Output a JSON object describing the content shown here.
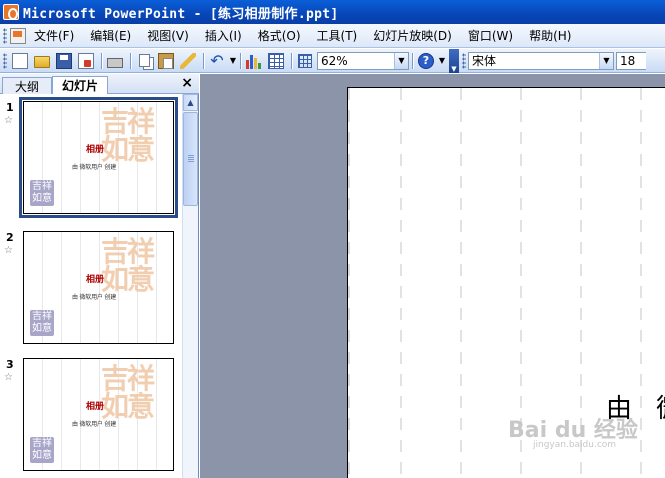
{
  "window": {
    "title": "Microsoft PowerPoint - [练习相册制作.ppt]"
  },
  "menu": {
    "items": [
      "文件(F)",
      "编辑(E)",
      "视图(V)",
      "插入(I)",
      "格式(O)",
      "工具(T)",
      "幻灯片放映(D)",
      "窗口(W)",
      "帮助(H)"
    ]
  },
  "toolbar": {
    "zoom_value": "62%",
    "font_name": "宋体",
    "font_size": "18"
  },
  "panel": {
    "tabs": [
      "大纲",
      "幻灯片"
    ],
    "active_tab": "幻灯片",
    "close_glyph": "×",
    "slides": [
      {
        "number": "1",
        "title": "相册",
        "subtitle": "由 微软用户 创建",
        "selected": true
      },
      {
        "number": "2",
        "title": "相册",
        "subtitle": "由 微软用户 创建",
        "selected": false
      },
      {
        "number": "3",
        "title": "相册",
        "subtitle": "由 微软用户 创建",
        "selected": false
      }
    ],
    "thumb_deco_text": "吉祥如意",
    "thumb_seal_text": "吉祥如意"
  },
  "canvas": {
    "visible_text": "由 微"
  },
  "watermark": {
    "brand": "Bai du 经验",
    "url": "jingyan.baidu.com"
  },
  "colors": {
    "titlebar": "#0a5fd8",
    "workspace": "#8b94a8",
    "thumb_title": "#b00000",
    "deco": "#f1c9a9",
    "seal": "#a7a6c9"
  }
}
